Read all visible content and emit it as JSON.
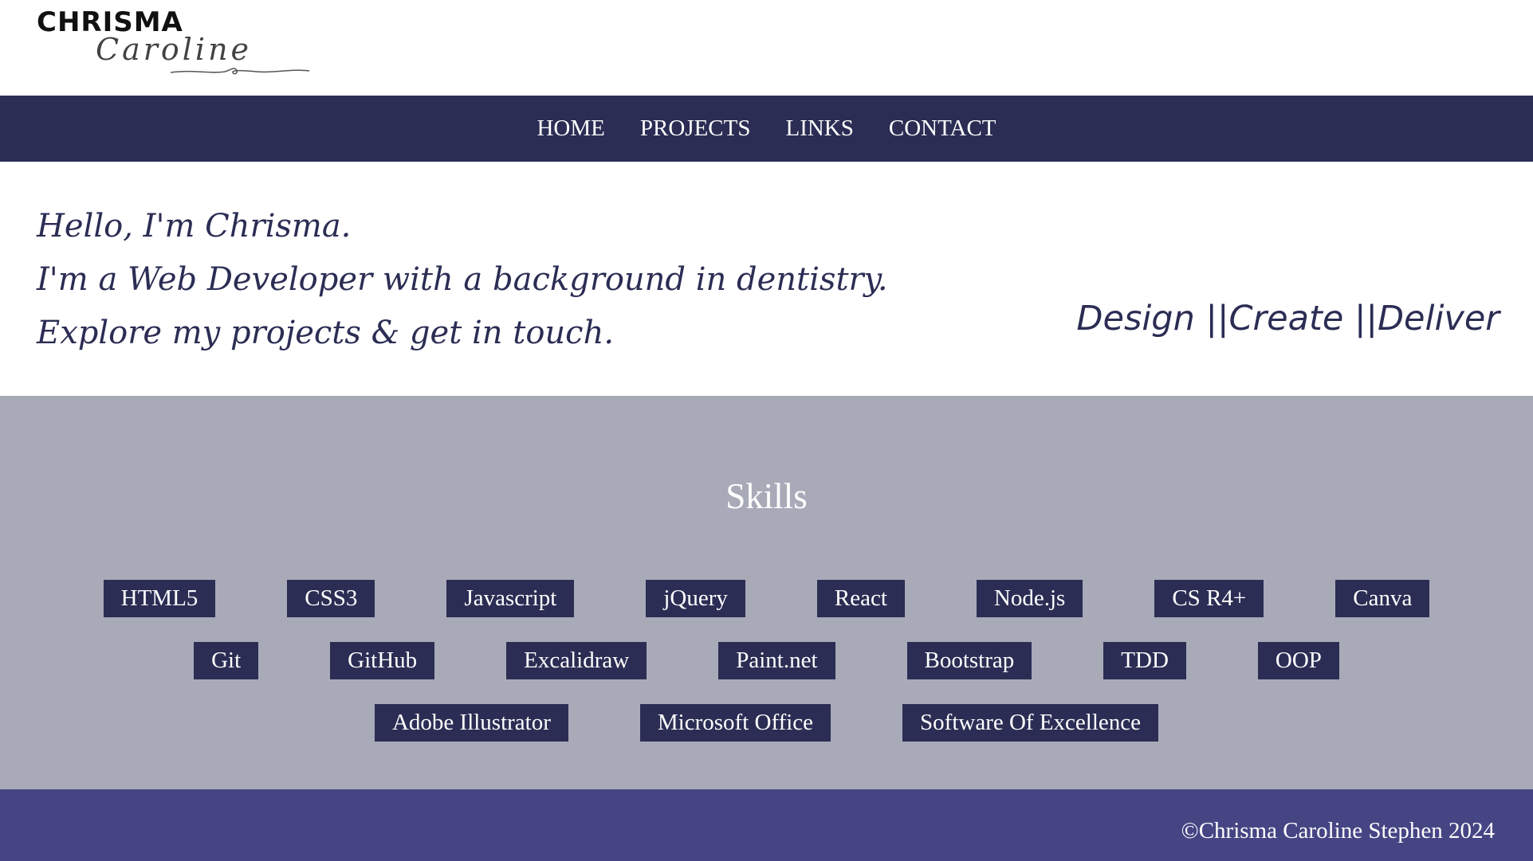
{
  "logo": {
    "top_text": "CHRISMA",
    "bottom_text": "Caroline"
  },
  "nav": {
    "items": [
      {
        "label": "HOME"
      },
      {
        "label": "PROJECTS"
      },
      {
        "label": "LINKS"
      },
      {
        "label": "CONTACT"
      }
    ]
  },
  "hero": {
    "intro_lines": [
      "Hello, I'm Chrisma.",
      "I'm a Web Developer with a background in dentistry.",
      "Explore my projects & get in touch."
    ],
    "tagline": "Design ||Create ||Deliver"
  },
  "skills": {
    "title": "Skills",
    "rows": [
      [
        "HTML5",
        "CSS3",
        "Javascript",
        "jQuery",
        "React",
        "Node.js",
        "CS R4+",
        "Canva"
      ],
      [
        "Git",
        "GitHub",
        "Excalidraw",
        "Paint.net",
        "Bootstrap",
        "TDD",
        "OOP"
      ],
      [
        "Adobe Illustrator",
        "Microsoft Office",
        "Software Of Excellence"
      ]
    ]
  },
  "footer": {
    "copyright": "©Chrisma Caroline Stephen 2024"
  },
  "colors": {
    "nav_bg": "#2b2d54",
    "skills_bg": "#a8aab8",
    "badge_bg": "#2b2d54",
    "footer_bg": "#464584",
    "text_accent": "#2b2d54"
  }
}
